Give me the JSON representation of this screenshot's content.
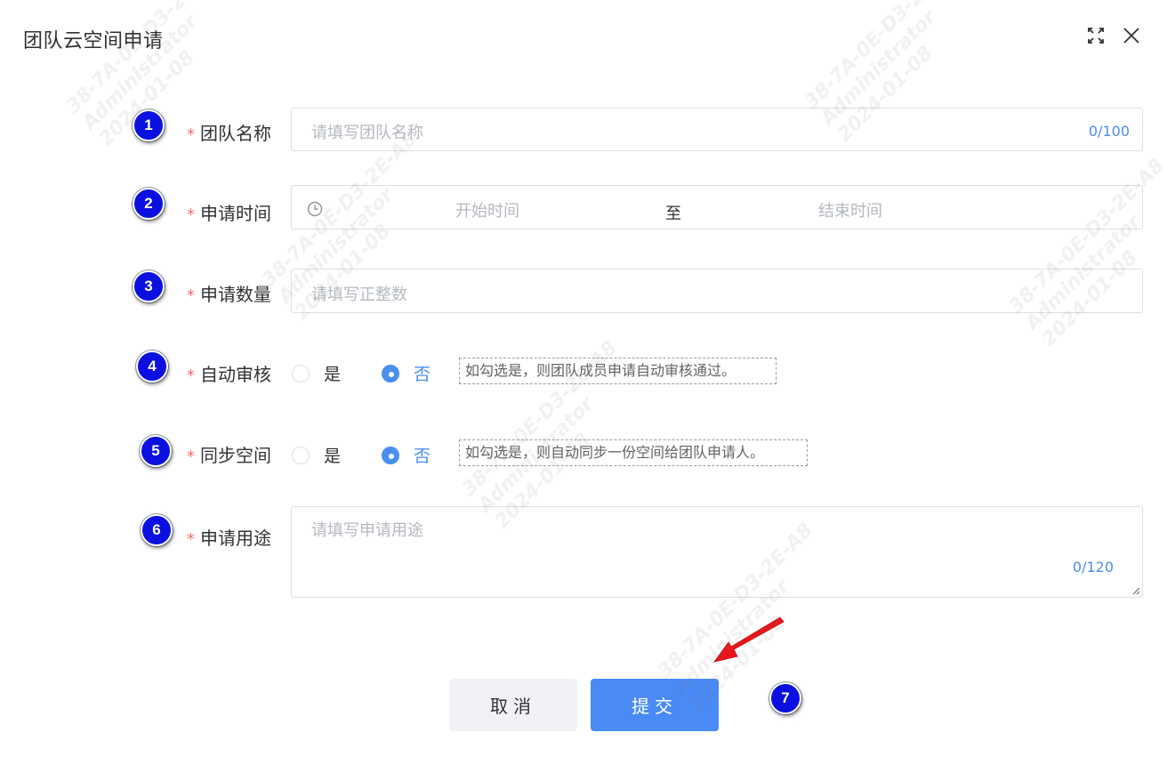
{
  "dialog": {
    "title": "团队云空间申请"
  },
  "fields": {
    "team_name": {
      "marker": "1",
      "required": "*",
      "label": "团队名称",
      "placeholder": "请填写团队名称",
      "counter": "0/100"
    },
    "apply_time": {
      "marker": "2",
      "required": "*",
      "label": "申请时间",
      "start_placeholder": "开始时间",
      "separator": "至",
      "end_placeholder": "结束时间"
    },
    "apply_quantity": {
      "marker": "3",
      "required": "*",
      "label": "申请数量",
      "placeholder": "请填写正整数"
    },
    "auto_review": {
      "marker": "4",
      "required": "*",
      "label": "自动审核",
      "option_yes": "是",
      "option_no": "否",
      "selected": "否",
      "hint": "如勾选是，则团队成员申请自动审核通过。"
    },
    "sync_space": {
      "marker": "5",
      "required": "*",
      "label": "同步空间",
      "option_yes": "是",
      "option_no": "否",
      "selected": "否",
      "hint": "如勾选是，则自动同步一份空间给团队申请人。"
    },
    "purpose": {
      "marker": "6",
      "required": "*",
      "label": "申请用途",
      "placeholder": "请填写申请用途",
      "counter": "0/120"
    }
  },
  "footer": {
    "cancel_label": "取消",
    "submit_label": "提交",
    "marker": "7"
  },
  "watermark": {
    "line1": "38-7A-0E-D3-2E-A8",
    "line2": "Administrator",
    "line3": "2024-01-08"
  },
  "colors": {
    "primary": "#4a8af4",
    "required": "#f56c6c",
    "marker": "#0b10e0",
    "arrow": "#e8161b"
  },
  "icons": {
    "fullscreen": "expand-icon",
    "close": "close-icon",
    "clock": "clock-icon",
    "arrow": "red-arrow-annotation"
  }
}
